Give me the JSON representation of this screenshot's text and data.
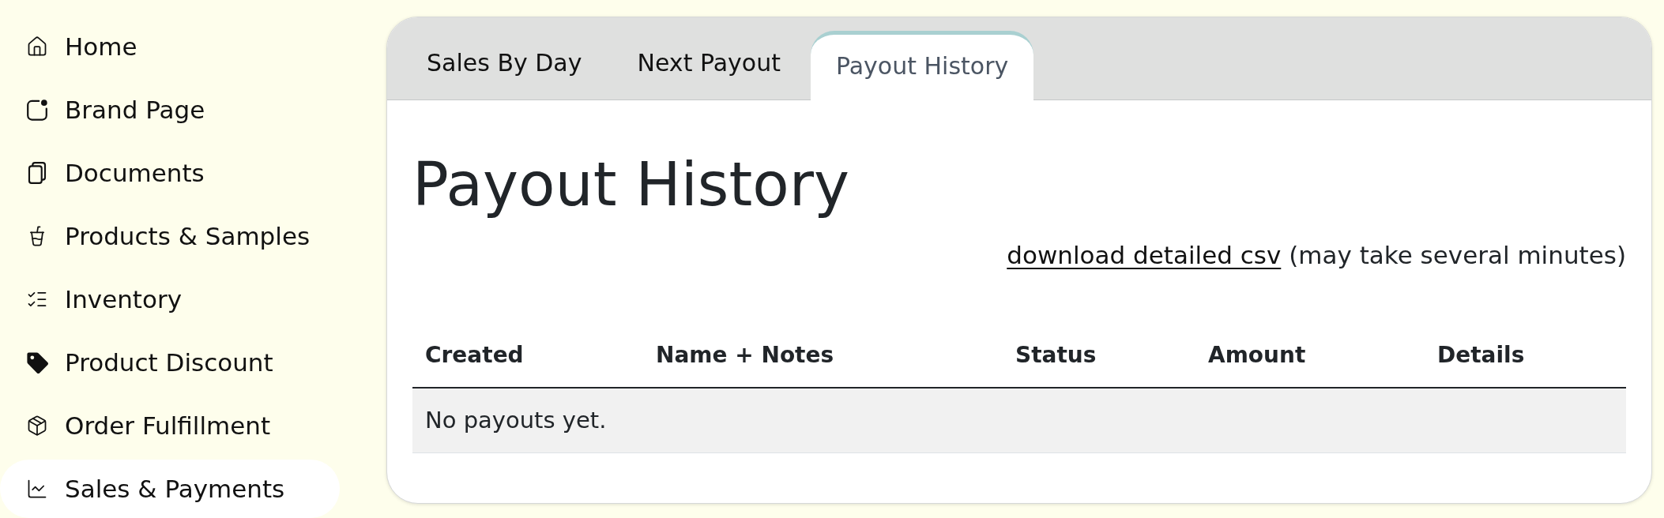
{
  "sidebar": {
    "items": [
      {
        "label": "Home",
        "selected": false
      },
      {
        "label": "Brand Page",
        "selected": false
      },
      {
        "label": "Documents",
        "selected": false
      },
      {
        "label": "Products & Samples",
        "selected": false
      },
      {
        "label": "Inventory",
        "selected": false
      },
      {
        "label": "Product Discount",
        "selected": false
      },
      {
        "label": "Order Fulfillment",
        "selected": false
      },
      {
        "label": "Sales & Payments",
        "selected": true
      }
    ]
  },
  "tabs": [
    {
      "label": "Sales By Day",
      "selected": false
    },
    {
      "label": "Next Payout",
      "selected": false
    },
    {
      "label": "Payout History",
      "selected": true
    }
  ],
  "heading": "Payout History",
  "download": {
    "link": "download detailed csv",
    "note": "(may take several minutes)"
  },
  "table": {
    "columns": [
      "Created",
      "Name + Notes",
      "Status",
      "Amount",
      "Details"
    ],
    "empty_message": "No payouts yet."
  }
}
